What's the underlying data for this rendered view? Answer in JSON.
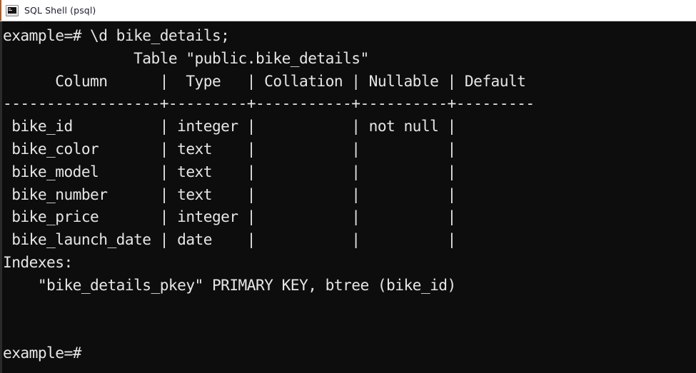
{
  "window": {
    "title": "SQL Shell (psql)",
    "icon": "console-icon"
  },
  "theme": {
    "titlebar_background": "#ffffff",
    "titlebar_text": "#1d1d2e",
    "terminal_background": "#0d0d0d",
    "terminal_text": "#e6e6e6",
    "gutter": "#2a2a2a"
  },
  "terminal": {
    "prompt": "example=#",
    "command": "\\d bike_details;",
    "table_caption": "Table \"public.bike_details\"",
    "columns": [
      {
        "header": "Column",
        "width": 18
      },
      {
        "header": "Type",
        "width": 10
      },
      {
        "header": "Collation",
        "width": 11
      },
      {
        "header": "Nullable",
        "width": 10
      },
      {
        "header": "Default",
        "width": 9
      }
    ],
    "rows": [
      {
        "column": "bike_id",
        "type": "integer",
        "collation": "",
        "nullable": "not null",
        "default": ""
      },
      {
        "column": "bike_color",
        "type": "text",
        "collation": "",
        "nullable": "",
        "default": ""
      },
      {
        "column": "bike_model",
        "type": "text",
        "collation": "",
        "nullable": "",
        "default": ""
      },
      {
        "column": "bike_number",
        "type": "text",
        "collation": "",
        "nullable": "",
        "default": ""
      },
      {
        "column": "bike_price",
        "type": "integer",
        "collation": "",
        "nullable": "",
        "default": ""
      },
      {
        "column": "bike_launch_date",
        "type": "date",
        "collation": "",
        "nullable": "",
        "default": ""
      }
    ],
    "indexes_label": "Indexes:",
    "indexes": [
      "\"bike_details_pkey\" PRIMARY KEY, btree (bike_id)"
    ],
    "trailing_prompt": "example=#",
    "lines": [
      "example=# \\d bike_details;",
      "               Table \"public.bike_details\"",
      "      Column      |  Type   | Collation | Nullable | Default ",
      "------------------+---------+-----------+----------+---------",
      " bike_id          | integer |           | not null | ",
      " bike_color       | text    |           |          | ",
      " bike_model       | text    |           |          | ",
      " bike_number      | text    |           |          | ",
      " bike_price       | integer |           |          | ",
      " bike_launch_date | date    |           |          | ",
      "Indexes:",
      "    \"bike_details_pkey\" PRIMARY KEY, btree (bike_id)",
      "",
      "",
      "example=#"
    ]
  }
}
